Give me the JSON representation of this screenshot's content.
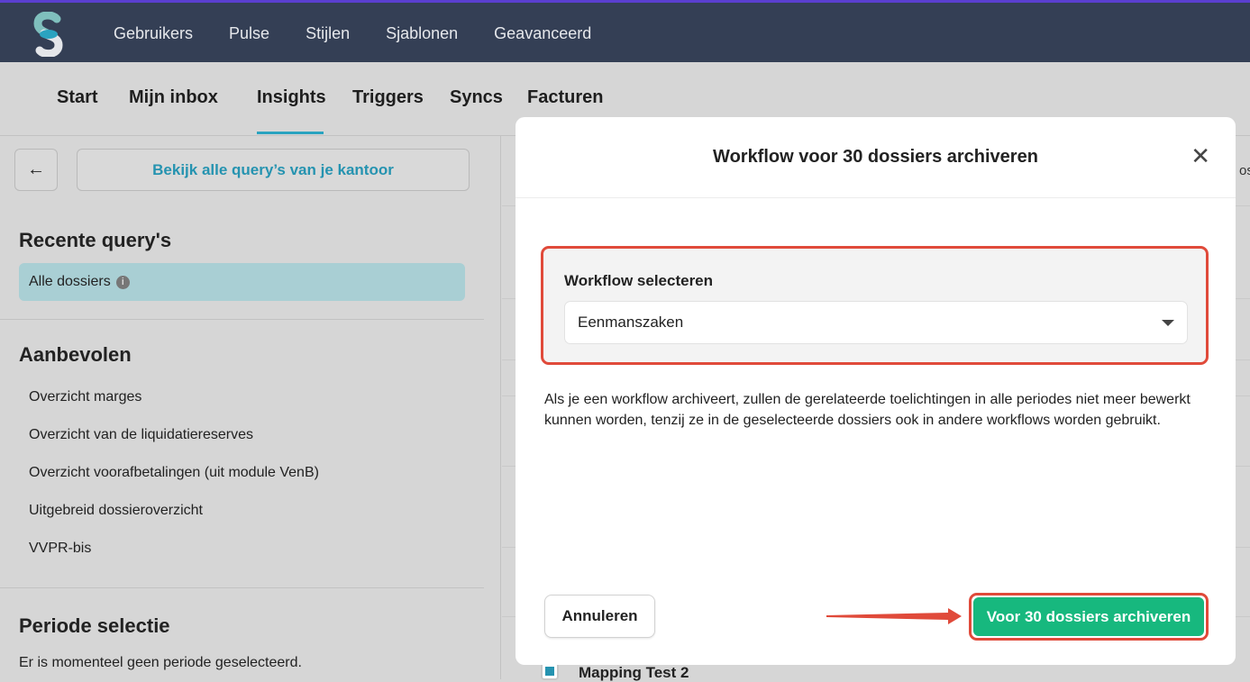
{
  "topnav": {
    "items": [
      "Gebruikers",
      "Pulse",
      "Stijlen",
      "Sjablonen",
      "Geavanceerd"
    ]
  },
  "subnav": {
    "tabs": [
      "Start",
      "Mijn inbox",
      "Insights",
      "Triggers",
      "Syncs",
      "Facturen"
    ],
    "active": "Insights"
  },
  "sidebar": {
    "back_icon": "arrow-left-icon",
    "all_queries_label": "Bekijk alle query’s van je kantoor",
    "recent_title": "Recente query's",
    "recent_items": [
      "Alle dossiers"
    ],
    "recommended_title": "Aanbevolen",
    "recommended_items": [
      "Overzicht marges",
      "Overzicht van de liquidatiereserves",
      "Overzicht voorafbetalingen (uit module VenB)",
      "Uitgebreid dossieroverzicht",
      "VVPR-bis"
    ],
    "period_title": "Periode selectie",
    "period_text": "Er is momenteel geen periode geselecteerd."
  },
  "background": {
    "edge_text": "oss",
    "row_label": "Mapping Test 2"
  },
  "modal": {
    "title": "Workflow voor 30 dossiers archiveren",
    "close_icon": "close-icon",
    "select_label": "Workflow selecteren",
    "select_value": "Eenmanszaken",
    "description": "Als je een workflow archiveert, zullen de gerelateerde toelichtingen in alle periodes niet meer bewerkt kunnen worden, tenzij ze in de geselecteerde dossiers ook in andere workflows worden gebruikt.",
    "cancel_label": "Annuleren",
    "confirm_label": "Voor 30 dossiers archiveren"
  },
  "colors": {
    "topbar": "#343f55",
    "accent": "#2593b0",
    "confirm": "#17b87e",
    "highlight": "#e04a3a"
  }
}
